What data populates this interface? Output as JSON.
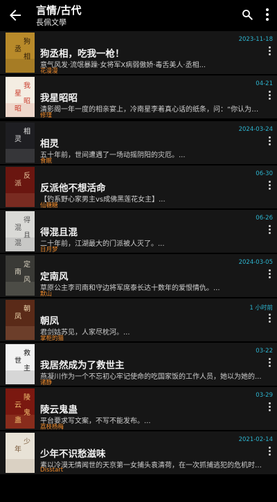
{
  "appbar": {
    "title": "言情/古代",
    "subtitle": "長佩文學",
    "icons": [
      "back-arrow-icon",
      "search-icon",
      "more-vert-icon"
    ]
  },
  "books": [
    {
      "title": "狗丞相，吃我一枪！",
      "desc": "意气风发·流氓暴躁·女将军X病弱傲娇·毒舌美人·丞相...",
      "author": "花漫漫",
      "date": "2023-11-18",
      "cover_bg": "#b88a2a",
      "cover_fg": "#2a1a08",
      "cover_text": "狗丞相"
    },
    {
      "title": "我星昭昭",
      "desc": "清影阁一年一度的相亲宴上，冷南星李着真心话的纸条，问：“你认为我们之...",
      "author": "修瑾",
      "date": "04-21",
      "cover_bg": "#f4ede2",
      "cover_fg": "#c93a2a",
      "cover_text": "我星昭昭"
    },
    {
      "title": "相灵",
      "desc": "五十年前，世间遭遇了一场动摇阴阳的灾厄。...",
      "author": "食眠",
      "date": "2024-03-24",
      "cover_bg": "#1e1e22",
      "cover_fg": "#e8e8e8",
      "cover_text": "相灵"
    },
    {
      "title": "反派他不想活命",
      "desc": "【钓系野心家男主vs成佛黑莲花女主】...",
      "author": "仙糖糖",
      "date": "06-30",
      "cover_bg": "#6a1610",
      "cover_fg": "#e8c9a0",
      "cover_text": "反派"
    },
    {
      "title": "得混且混",
      "desc": "二十年前，江湖最大的门派被人灭了。...",
      "author": "日月梦",
      "date": "06-26",
      "cover_bg": "#d9d9d6",
      "cover_fg": "#555555",
      "cover_text": "得混且混"
    },
    {
      "title": "定南风",
      "desc": "草原公主李司南和守边将军席泰长达十数年的爱恨情仇。...",
      "author": "默山",
      "date": "2024-03-05",
      "cover_bg": "#3a3a36",
      "cover_fg": "#d9d2c0",
      "cover_text": "定南风"
    },
    {
      "title": "朝凤",
      "desc": "君剑姑苏见，人家尽枕河。...",
      "author": "掌柜的猫",
      "date": "1 小时前",
      "cover_bg": "#5a2a18",
      "cover_fg": "#f0d9b0",
      "cover_text": "朝凤"
    },
    {
      "title": "我居然成为了救世主",
      "desc": "燕凝川作为一个不忘初心牢记使命的吃国家饭的工作人员，她以为她的...",
      "author": "诸静",
      "date": "03-22",
      "cover_bg": "#f2f2f2",
      "cover_fg": "#111111",
      "cover_text": "救世主"
    },
    {
      "title": "陵云鬼蛊",
      "desc": "平台要求写文案，不写不能发布。...",
      "author": "荔枝杨梅",
      "date": "03-29",
      "cover_bg": "#7a1810",
      "cover_fg": "#f0c070",
      "cover_text": "陵云鬼蛊"
    },
    {
      "title": "少年不识愁滋味",
      "desc": "素以冷漠无情闻世的天京第一女捕头袁清荷，在一次抓捕逃犯的危机时刻恰...",
      "author": "Disstart",
      "date": "2021-02-14",
      "cover_bg": "#e8e2d6",
      "cover_fg": "#7a5a3a",
      "cover_text": "少年"
    }
  ],
  "colors": {
    "background": "#000000",
    "card": "#161616",
    "date": "#2db5d0",
    "author": "#f08a2a"
  }
}
